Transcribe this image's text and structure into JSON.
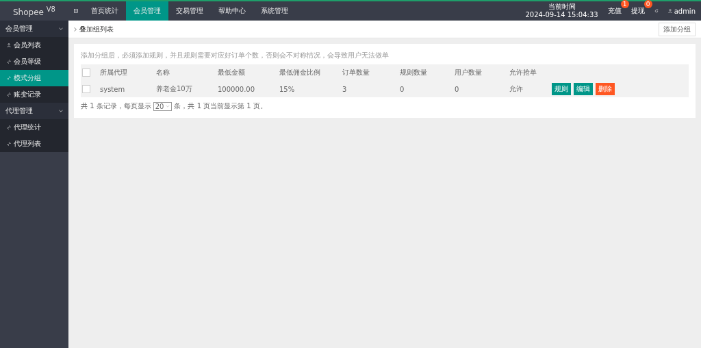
{
  "logo": {
    "name": "Shopee",
    "version": "V8"
  },
  "top_nav": [
    {
      "label": "首页统计",
      "selected": false
    },
    {
      "label": "会员管理",
      "selected": true
    },
    {
      "label": "交易管理",
      "selected": false
    },
    {
      "label": "帮助中心",
      "selected": false
    },
    {
      "label": "系统管理",
      "selected": false
    }
  ],
  "clock": {
    "label": "当前时间",
    "time": "2024-09-14 15:04:33"
  },
  "top_actions": [
    {
      "label": "充值",
      "badge": "1"
    },
    {
      "label": "提现",
      "badge": "0"
    }
  ],
  "user": "admin",
  "sidebar": [
    {
      "label": "会员管理",
      "expanded": true,
      "children": [
        {
          "label": "会员列表",
          "selected": false
        },
        {
          "label": "会员等级",
          "selected": false
        },
        {
          "label": "模式分组",
          "selected": true
        },
        {
          "label": "账变记录",
          "selected": false
        }
      ]
    },
    {
      "label": "代理管理",
      "expanded": true,
      "children": [
        {
          "label": "代理统计",
          "selected": false
        },
        {
          "label": "代理列表",
          "selected": false
        }
      ]
    }
  ],
  "breadcrumb": "叠加组列表",
  "add_button": "添加分组",
  "hint": "添加分组后，必须添加规则，并且规则需要对应好订单个数，否则会不对称情况，会导致用户无法做单",
  "table": {
    "header_checked": false,
    "columns": [
      "所属代理",
      "名称",
      "最低金额",
      "最低佣金比例",
      "订单数量",
      "规则数量",
      "用户数量",
      "允许抢单"
    ],
    "rows": [
      {
        "checked": false,
        "cells": [
          "system",
          "养老金10万",
          "100000.00",
          "15%",
          "3",
          "0",
          "0",
          "允许"
        ],
        "actions": [
          {
            "label": "规则",
            "kind": "primary"
          },
          {
            "label": "编辑",
            "kind": "primary"
          },
          {
            "label": "删除",
            "kind": "danger"
          }
        ]
      }
    ]
  },
  "pagination": {
    "before": "共 1 条记录，每页显示",
    "page_size": "20",
    "after": "条，共 1 页当前显示第 1 页。"
  }
}
